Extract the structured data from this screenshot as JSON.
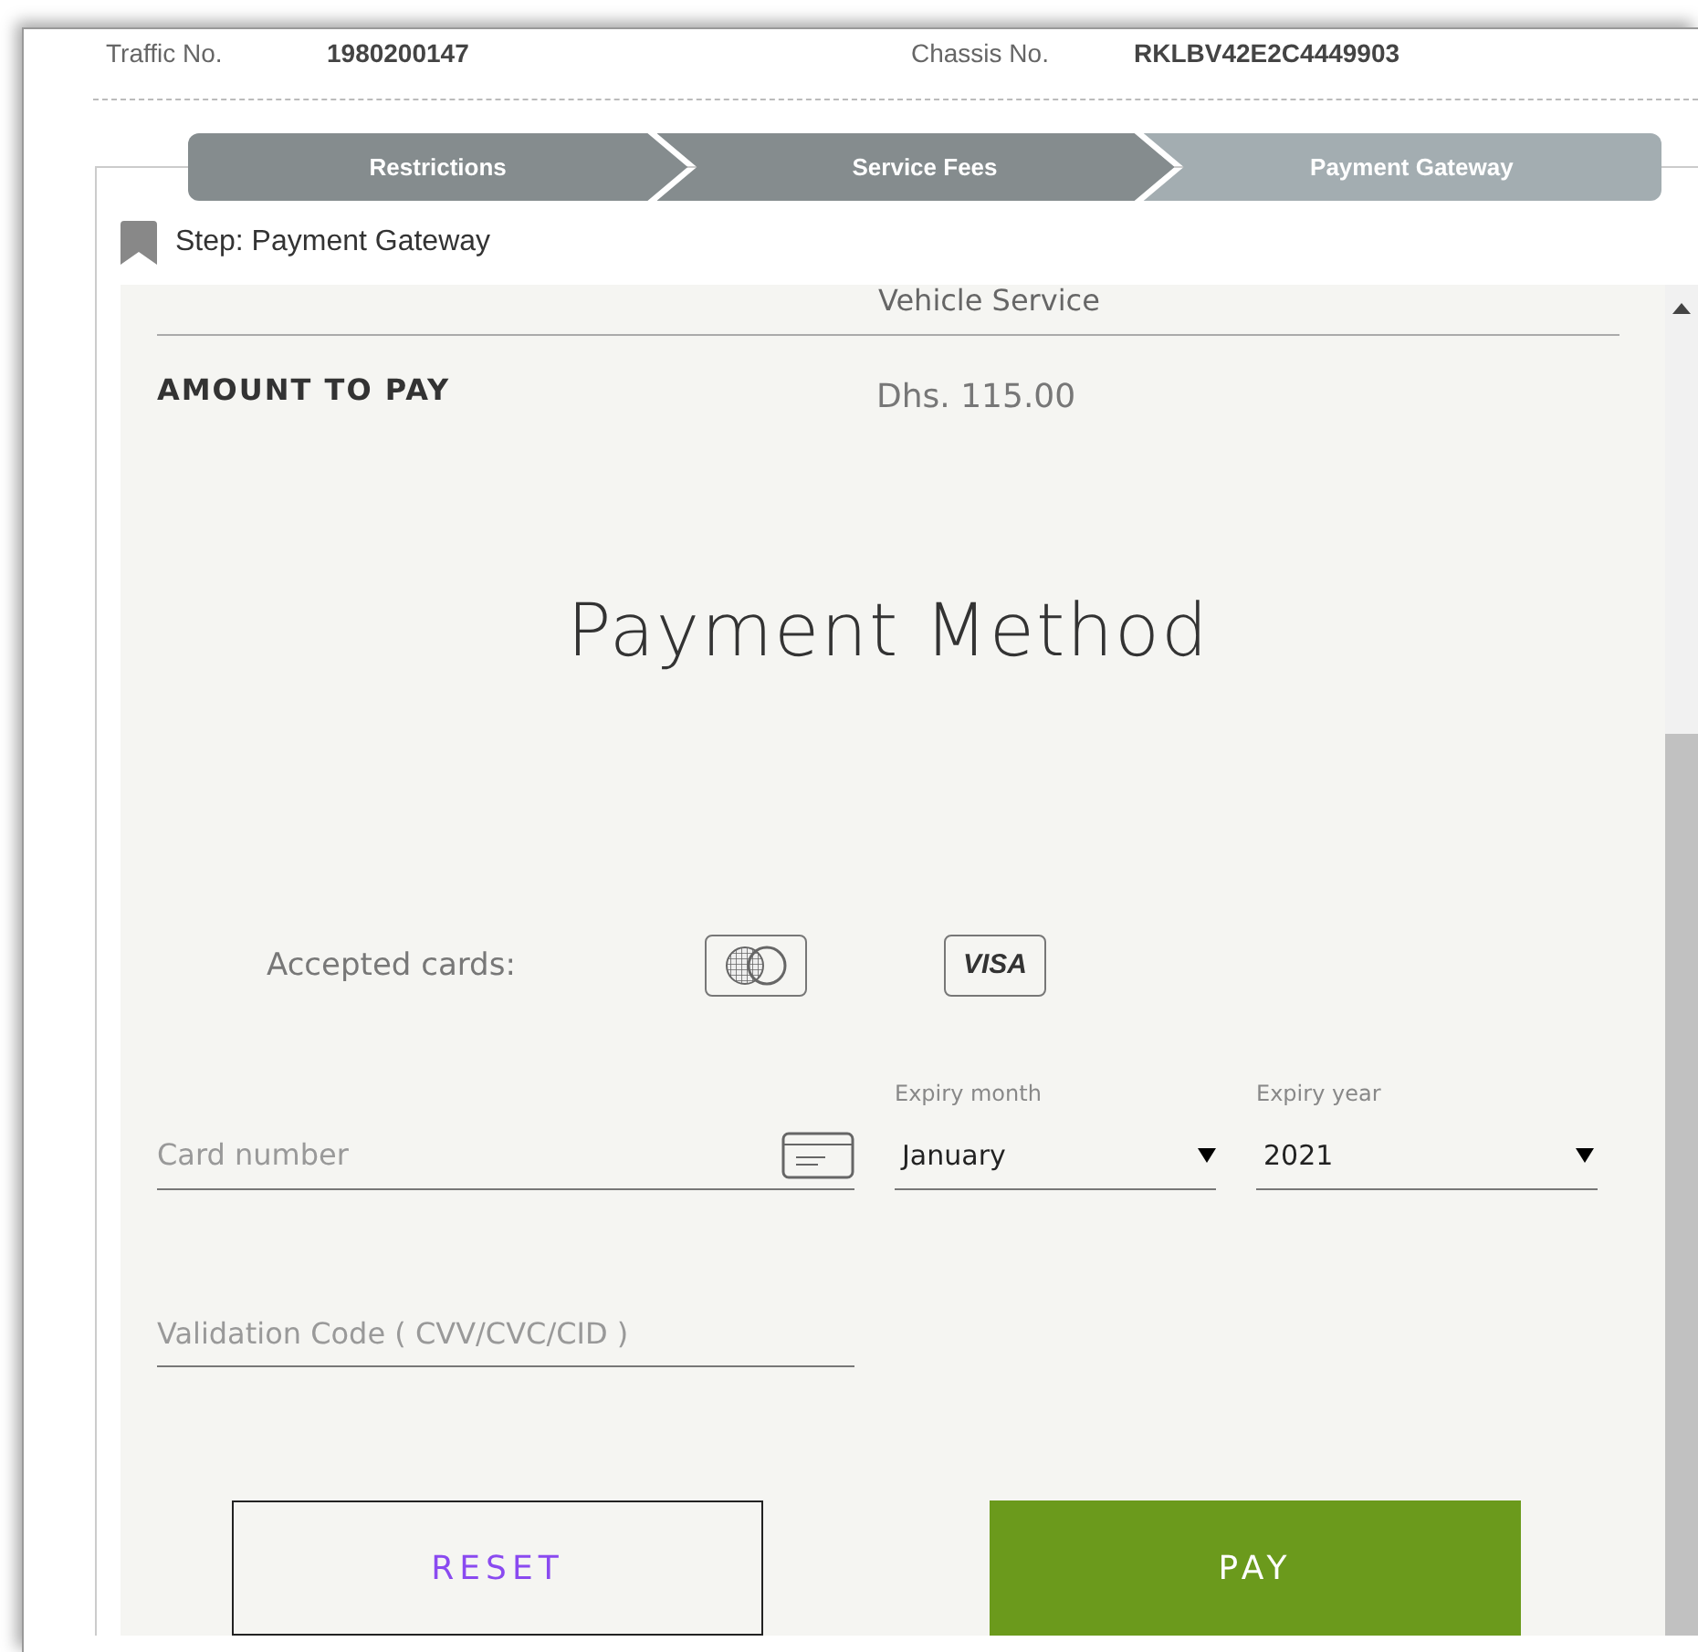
{
  "vehicle": {
    "fields": [
      {
        "label": "Traffic No.",
        "value": "1980200147"
      },
      {
        "label": "Chassis No.",
        "value": "RKLBV42E2C4449903"
      }
    ]
  },
  "steps": [
    {
      "label": "Restrictions",
      "selected": false
    },
    {
      "label": "Service Fees",
      "selected": false
    },
    {
      "label": "Payment Gateway",
      "selected": true
    }
  ],
  "step_caption": "Step: Payment Gateway",
  "summary": {
    "service_line": "Vehicle Service",
    "amount_label": "AMOUNT TO PAY",
    "amount_value": "Dhs. 115.00"
  },
  "payment": {
    "title": "Payment Method",
    "accepted_label": "Accepted cards:",
    "cards": [
      {
        "kind": "mastercard"
      },
      {
        "kind": "visa",
        "text": "VISA"
      }
    ],
    "card_number": {
      "placeholder": "Card number"
    },
    "expiry_month": {
      "label": "Expiry month",
      "value": "January"
    },
    "expiry_year": {
      "label": "Expiry year",
      "value": "2021"
    },
    "cvv": {
      "placeholder": "Validation Code ( CVV/CVC/CID )"
    },
    "buttons": [
      {
        "kind": "reset",
        "label": "RESET"
      },
      {
        "kind": "pay",
        "label": "PAY"
      }
    ]
  }
}
